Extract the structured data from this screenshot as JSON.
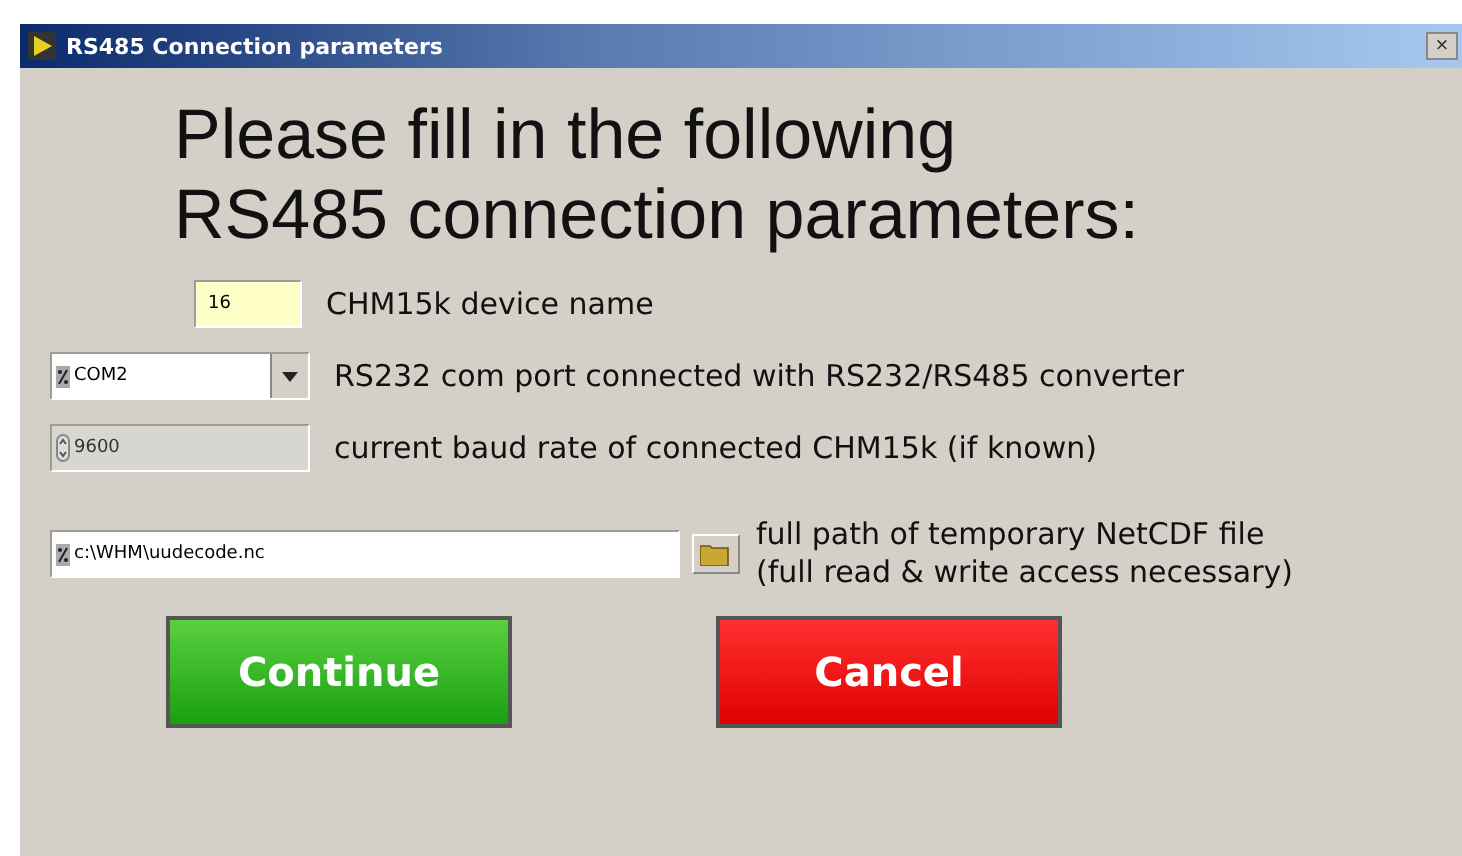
{
  "window": {
    "title": "RS485 Connection parameters",
    "close": "×"
  },
  "heading": [
    "Please fill in the following",
    "RS485 connection parameters:"
  ],
  "fields": [
    {
      "kind": "text",
      "value": "16",
      "disabled": false,
      "label": [
        "CHM15k device name"
      ]
    },
    {
      "kind": "dropdown",
      "value": "COM2",
      "disabled": false,
      "label": [
        "RS232 com port connected with RS232/RS485 converter"
      ]
    },
    {
      "kind": "numeric",
      "value": "9600",
      "disabled": true,
      "label": [
        "current baud rate of connected CHM15k (if known)"
      ]
    },
    {
      "kind": "path",
      "value": "c:\\WHM\\uudecode.nc",
      "disabled": false,
      "label": [
        "full path of temporary NetCDF file",
        "(full read & write access necessary)"
      ]
    }
  ],
  "buttons": [
    {
      "label": "Continue",
      "kind": "ok"
    },
    {
      "label": "Cancel",
      "kind": "cancel"
    }
  ]
}
